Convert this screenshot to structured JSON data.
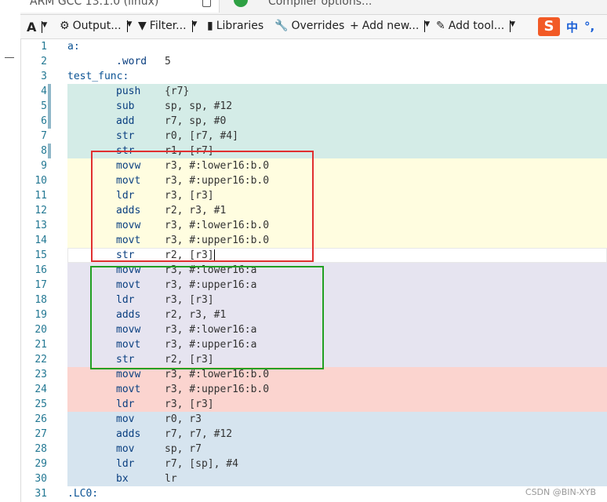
{
  "tabs": {
    "active_title": "ARM GCC 13.1.0 (linux)",
    "second_title": "Compiler options..."
  },
  "toolbar": {
    "font_label": "A",
    "output_label": "Output...",
    "filter_label": "Filter...",
    "libraries_label": "Libraries",
    "overrides_label": "Overrides",
    "add_new_label": "Add new...",
    "add_tool_label": "Add tool..."
  },
  "ime": {
    "logo": "S",
    "lang": "中",
    "punct": "°,"
  },
  "colors": {
    "block_teal": "#d4ece7",
    "block_yellow": "#fffde0",
    "block_lavender": "#e6e4f0",
    "block_red": "#fbd4cf",
    "block_blue": "#d6e4ef",
    "highlight_red": "#e03030",
    "highlight_green": "#22a022"
  },
  "lines": [
    {
      "n": "1",
      "indent": 0,
      "op": "a:",
      "args": "",
      "block": "none"
    },
    {
      "n": "2",
      "indent": 1,
      "op": ".word",
      "args": "5",
      "block": "none"
    },
    {
      "n": "3",
      "indent": 0,
      "op": "test_func:",
      "args": "",
      "block": "none"
    },
    {
      "n": "4",
      "indent": 1,
      "op": "push",
      "args": "{r7}",
      "block": "teal"
    },
    {
      "n": "5",
      "indent": 1,
      "op": "sub",
      "args": "sp, sp, #12",
      "block": "teal"
    },
    {
      "n": "6",
      "indent": 1,
      "op": "add",
      "args": "r7, sp, #0",
      "block": "teal"
    },
    {
      "n": "7",
      "indent": 1,
      "op": "str",
      "args": "r0, [r7, #4]",
      "block": "teal"
    },
    {
      "n": "8",
      "indent": 1,
      "op": "str",
      "args": "r1, [r7]",
      "block": "teal"
    },
    {
      "n": "9",
      "indent": 1,
      "op": "movw",
      "args": "r3, #:lower16:b.0",
      "block": "yellow"
    },
    {
      "n": "10",
      "indent": 1,
      "op": "movt",
      "args": "r3, #:upper16:b.0",
      "block": "yellow"
    },
    {
      "n": "11",
      "indent": 1,
      "op": "ldr",
      "args": "r3, [r3]",
      "block": "yellow"
    },
    {
      "n": "12",
      "indent": 1,
      "op": "adds",
      "args": "r2, r3, #1",
      "block": "yellow"
    },
    {
      "n": "13",
      "indent": 1,
      "op": "movw",
      "args": "r3, #:lower16:b.0",
      "block": "yellow"
    },
    {
      "n": "14",
      "indent": 1,
      "op": "movt",
      "args": "r3, #:upper16:b.0",
      "block": "yellow"
    },
    {
      "n": "15",
      "indent": 1,
      "op": "str",
      "args": "r2, [r3]",
      "block": "cursor"
    },
    {
      "n": "16",
      "indent": 1,
      "op": "movw",
      "args": "r3, #:lower16:a",
      "block": "lavender"
    },
    {
      "n": "17",
      "indent": 1,
      "op": "movt",
      "args": "r3, #:upper16:a",
      "block": "lavender"
    },
    {
      "n": "18",
      "indent": 1,
      "op": "ldr",
      "args": "r3, [r3]",
      "block": "lavender"
    },
    {
      "n": "19",
      "indent": 1,
      "op": "adds",
      "args": "r2, r3, #1",
      "block": "lavender"
    },
    {
      "n": "20",
      "indent": 1,
      "op": "movw",
      "args": "r3, #:lower16:a",
      "block": "lavender"
    },
    {
      "n": "21",
      "indent": 1,
      "op": "movt",
      "args": "r3, #:upper16:a",
      "block": "lavender"
    },
    {
      "n": "22",
      "indent": 1,
      "op": "str",
      "args": "r2, [r3]",
      "block": "lavender"
    },
    {
      "n": "23",
      "indent": 1,
      "op": "movw",
      "args": "r3, #:lower16:b.0",
      "block": "red"
    },
    {
      "n": "24",
      "indent": 1,
      "op": "movt",
      "args": "r3, #:upper16:b.0",
      "block": "red"
    },
    {
      "n": "25",
      "indent": 1,
      "op": "ldr",
      "args": "r3, [r3]",
      "block": "red"
    },
    {
      "n": "26",
      "indent": 1,
      "op": "mov",
      "args": "r0, r3",
      "block": "blue"
    },
    {
      "n": "27",
      "indent": 1,
      "op": "adds",
      "args": "r7, r7, #12",
      "block": "blue"
    },
    {
      "n": "28",
      "indent": 1,
      "op": "mov",
      "args": "sp, r7",
      "block": "blue"
    },
    {
      "n": "29",
      "indent": 1,
      "op": "ldr",
      "args": "r7, [sp], #4",
      "block": "blue"
    },
    {
      "n": "30",
      "indent": 1,
      "op": "bx",
      "args": "lr",
      "block": "blue"
    },
    {
      "n": "31",
      "indent": 0,
      "op": ".LC0:",
      "args": "",
      "block": "none"
    }
  ],
  "watermark": "CSDN @BIN-XYB"
}
